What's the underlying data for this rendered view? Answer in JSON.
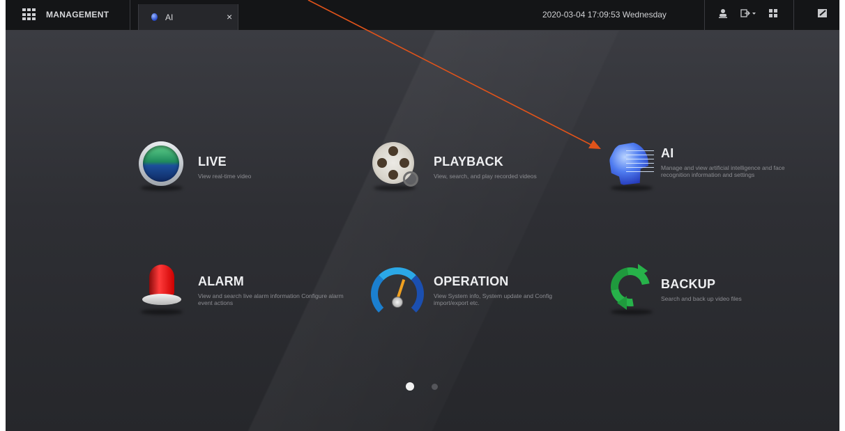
{
  "topbar": {
    "management_label": "MANAGEMENT",
    "tab_label": "AI",
    "tab_close": "×",
    "datetime": "2020-03-04 17:09:53 Wednesday",
    "icons": [
      "grid-menu-icon",
      "user-icon",
      "logout-icon",
      "layout-icon",
      "screen-icon"
    ]
  },
  "tiles": [
    {
      "id": "live",
      "title": "LIVE",
      "desc": "View real-time video",
      "icon": "live-icon"
    },
    {
      "id": "playback",
      "title": "PLAYBACK",
      "desc": "View, search, and play recorded videos",
      "icon": "film-reel-icon"
    },
    {
      "id": "ai",
      "title": "AI",
      "desc": "Manage and view artificial intelligence and face recognition information and settings",
      "icon": "ai-head-icon"
    },
    {
      "id": "alarm",
      "title": "ALARM",
      "desc": "View and search live alarm information Configure alarm event actions",
      "icon": "alarm-light-icon"
    },
    {
      "id": "operation",
      "title": "OPERATION",
      "desc": "View System info, System update and Config import/export etc.",
      "icon": "gauge-icon"
    },
    {
      "id": "backup",
      "title": "BACKUP",
      "desc": "Search and back up video files",
      "icon": "sync-arrows-icon"
    }
  ],
  "pagination": {
    "total": 2,
    "active": 1
  },
  "colors": {
    "background": "#2b2c31",
    "topbar": "#141517",
    "annotation_arrow": "#e0531a"
  }
}
